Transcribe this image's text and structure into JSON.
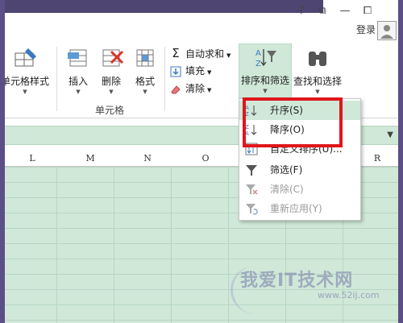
{
  "window": {
    "controls": [
      "?",
      "⧉",
      "—",
      "⧠"
    ],
    "login_label": "登录"
  },
  "ribbon": {
    "cells_group": {
      "label": "单元格",
      "cell_style_label": "单元格样式",
      "insert_label": "插入",
      "delete_label": "删除",
      "format_label": "格式"
    },
    "editing": {
      "autosum_label": "自动求和",
      "fill_label": "填充",
      "clear_label": "清除",
      "sort_filter_label": "排序和筛选",
      "find_select_label": "查找和选择"
    }
  },
  "columns": [
    "L",
    "M",
    "N",
    "O",
    "R"
  ],
  "sort_menu": {
    "items": [
      {
        "label": "升序(S)",
        "icon": "sort-ascending-icon",
        "enabled": true
      },
      {
        "label": "降序(O)",
        "icon": "sort-descending-icon",
        "enabled": true
      },
      {
        "label": "自定义排序(U)...",
        "icon": "custom-sort-icon",
        "enabled": true
      },
      {
        "label": "筛选(F)",
        "icon": "filter-icon",
        "enabled": true
      },
      {
        "label": "清除(C)",
        "icon": "clear-filter-icon",
        "enabled": false
      },
      {
        "label": "重新应用(Y)",
        "icon": "reapply-icon",
        "enabled": false
      }
    ]
  },
  "watermark": {
    "text": "我爱IT技术网",
    "url": "www.52ij.com"
  },
  "colors": {
    "accent_green": "#cfe8d8",
    "highlight_red": "#e0161c",
    "frame_purple": "#5b4f86"
  }
}
